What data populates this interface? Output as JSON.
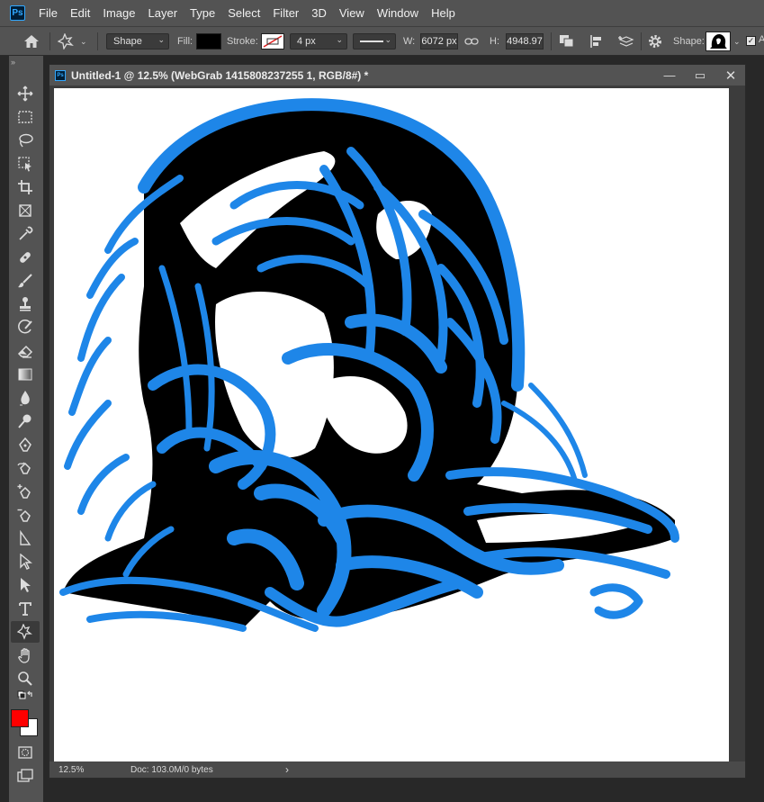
{
  "menubar": {
    "logo": "Ps",
    "items": [
      "File",
      "Edit",
      "Image",
      "Layer",
      "Type",
      "Select",
      "Filter",
      "3D",
      "View",
      "Window",
      "Help"
    ]
  },
  "options": {
    "mode": "Shape",
    "fill_label": "Fill:",
    "fill_color": "#000000",
    "stroke_label": "Stroke:",
    "stroke_width": "4 px",
    "w_label": "W:",
    "w_value": "6072 px",
    "h_label": "H:",
    "h_value": "4948.97",
    "shape_label": "Shape:"
  },
  "toolbar": {
    "collapse": "»",
    "foreground_color": "#ff0000",
    "background_color": "#ffffff"
  },
  "document": {
    "tab_logo": "Ps",
    "title": "Untitled-1 @ 12.5% (WebGrab 1415808237255 1, RGB/8#) *",
    "path_color": "#1e86e8",
    "zoom": "12.5%",
    "doc_info": "Doc: 103.0M/0 bytes",
    "status_arrow": "›"
  }
}
